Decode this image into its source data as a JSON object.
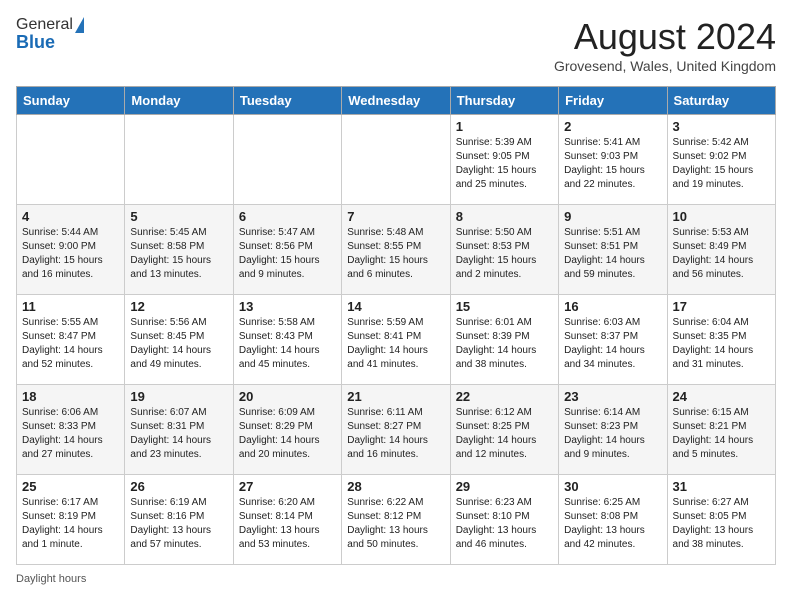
{
  "header": {
    "logo_general": "General",
    "logo_blue": "Blue",
    "month_title": "August 2024",
    "location": "Grovesend, Wales, United Kingdom"
  },
  "weekdays": [
    "Sunday",
    "Monday",
    "Tuesday",
    "Wednesday",
    "Thursday",
    "Friday",
    "Saturday"
  ],
  "footer": {
    "daylight_label": "Daylight hours"
  },
  "weeks": [
    [
      {
        "day": "",
        "info": ""
      },
      {
        "day": "",
        "info": ""
      },
      {
        "day": "",
        "info": ""
      },
      {
        "day": "",
        "info": ""
      },
      {
        "day": "1",
        "info": "Sunrise: 5:39 AM\nSunset: 9:05 PM\nDaylight: 15 hours\nand 25 minutes."
      },
      {
        "day": "2",
        "info": "Sunrise: 5:41 AM\nSunset: 9:03 PM\nDaylight: 15 hours\nand 22 minutes."
      },
      {
        "day": "3",
        "info": "Sunrise: 5:42 AM\nSunset: 9:02 PM\nDaylight: 15 hours\nand 19 minutes."
      }
    ],
    [
      {
        "day": "4",
        "info": "Sunrise: 5:44 AM\nSunset: 9:00 PM\nDaylight: 15 hours\nand 16 minutes."
      },
      {
        "day": "5",
        "info": "Sunrise: 5:45 AM\nSunset: 8:58 PM\nDaylight: 15 hours\nand 13 minutes."
      },
      {
        "day": "6",
        "info": "Sunrise: 5:47 AM\nSunset: 8:56 PM\nDaylight: 15 hours\nand 9 minutes."
      },
      {
        "day": "7",
        "info": "Sunrise: 5:48 AM\nSunset: 8:55 PM\nDaylight: 15 hours\nand 6 minutes."
      },
      {
        "day": "8",
        "info": "Sunrise: 5:50 AM\nSunset: 8:53 PM\nDaylight: 15 hours\nand 2 minutes."
      },
      {
        "day": "9",
        "info": "Sunrise: 5:51 AM\nSunset: 8:51 PM\nDaylight: 14 hours\nand 59 minutes."
      },
      {
        "day": "10",
        "info": "Sunrise: 5:53 AM\nSunset: 8:49 PM\nDaylight: 14 hours\nand 56 minutes."
      }
    ],
    [
      {
        "day": "11",
        "info": "Sunrise: 5:55 AM\nSunset: 8:47 PM\nDaylight: 14 hours\nand 52 minutes."
      },
      {
        "day": "12",
        "info": "Sunrise: 5:56 AM\nSunset: 8:45 PM\nDaylight: 14 hours\nand 49 minutes."
      },
      {
        "day": "13",
        "info": "Sunrise: 5:58 AM\nSunset: 8:43 PM\nDaylight: 14 hours\nand 45 minutes."
      },
      {
        "day": "14",
        "info": "Sunrise: 5:59 AM\nSunset: 8:41 PM\nDaylight: 14 hours\nand 41 minutes."
      },
      {
        "day": "15",
        "info": "Sunrise: 6:01 AM\nSunset: 8:39 PM\nDaylight: 14 hours\nand 38 minutes."
      },
      {
        "day": "16",
        "info": "Sunrise: 6:03 AM\nSunset: 8:37 PM\nDaylight: 14 hours\nand 34 minutes."
      },
      {
        "day": "17",
        "info": "Sunrise: 6:04 AM\nSunset: 8:35 PM\nDaylight: 14 hours\nand 31 minutes."
      }
    ],
    [
      {
        "day": "18",
        "info": "Sunrise: 6:06 AM\nSunset: 8:33 PM\nDaylight: 14 hours\nand 27 minutes."
      },
      {
        "day": "19",
        "info": "Sunrise: 6:07 AM\nSunset: 8:31 PM\nDaylight: 14 hours\nand 23 minutes."
      },
      {
        "day": "20",
        "info": "Sunrise: 6:09 AM\nSunset: 8:29 PM\nDaylight: 14 hours\nand 20 minutes."
      },
      {
        "day": "21",
        "info": "Sunrise: 6:11 AM\nSunset: 8:27 PM\nDaylight: 14 hours\nand 16 minutes."
      },
      {
        "day": "22",
        "info": "Sunrise: 6:12 AM\nSunset: 8:25 PM\nDaylight: 14 hours\nand 12 minutes."
      },
      {
        "day": "23",
        "info": "Sunrise: 6:14 AM\nSunset: 8:23 PM\nDaylight: 14 hours\nand 9 minutes."
      },
      {
        "day": "24",
        "info": "Sunrise: 6:15 AM\nSunset: 8:21 PM\nDaylight: 14 hours\nand 5 minutes."
      }
    ],
    [
      {
        "day": "25",
        "info": "Sunrise: 6:17 AM\nSunset: 8:19 PM\nDaylight: 14 hours\nand 1 minute."
      },
      {
        "day": "26",
        "info": "Sunrise: 6:19 AM\nSunset: 8:16 PM\nDaylight: 13 hours\nand 57 minutes."
      },
      {
        "day": "27",
        "info": "Sunrise: 6:20 AM\nSunset: 8:14 PM\nDaylight: 13 hours\nand 53 minutes."
      },
      {
        "day": "28",
        "info": "Sunrise: 6:22 AM\nSunset: 8:12 PM\nDaylight: 13 hours\nand 50 minutes."
      },
      {
        "day": "29",
        "info": "Sunrise: 6:23 AM\nSunset: 8:10 PM\nDaylight: 13 hours\nand 46 minutes."
      },
      {
        "day": "30",
        "info": "Sunrise: 6:25 AM\nSunset: 8:08 PM\nDaylight: 13 hours\nand 42 minutes."
      },
      {
        "day": "31",
        "info": "Sunrise: 6:27 AM\nSunset: 8:05 PM\nDaylight: 13 hours\nand 38 minutes."
      }
    ]
  ]
}
